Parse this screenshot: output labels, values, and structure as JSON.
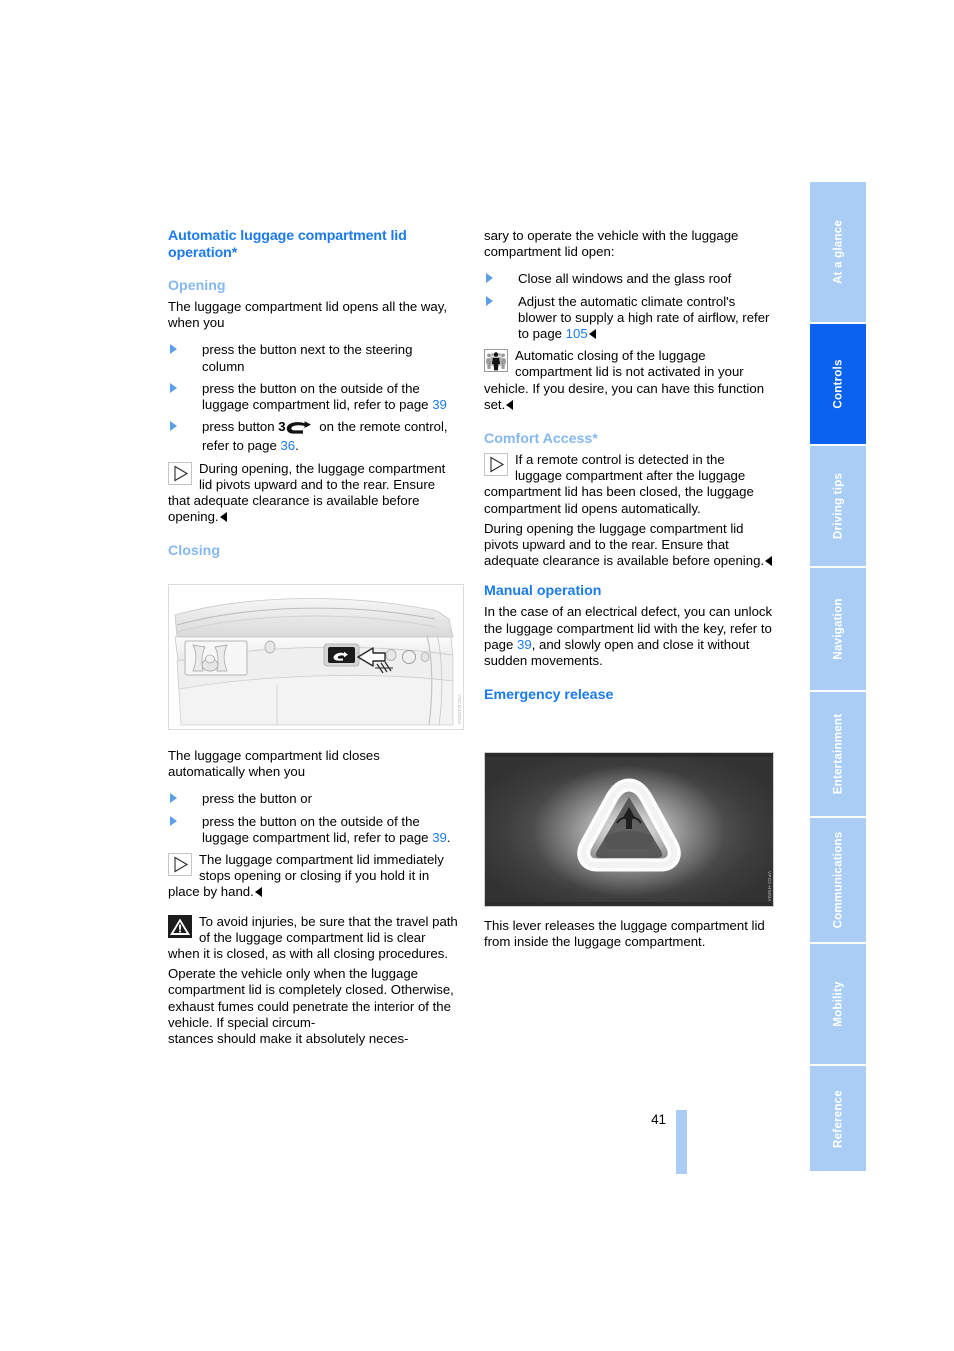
{
  "page": {
    "number": "41",
    "accent_blue": "#1a7aee",
    "light_blue": "#85b8f0",
    "tab_blue": "#a9cdf5",
    "tab_active_blue": "#0a62f0"
  },
  "left_column": {
    "section_title": "Automatic luggage compartment lid operation*",
    "opening": {
      "heading": "Opening",
      "intro": "The luggage compartment lid opens all the way, when you",
      "bullets": [
        {
          "text": "press the button next to the steering column"
        },
        {
          "text_before": "press the button on the outside of the luggage compartment lid, refer to page ",
          "page_ref": "39",
          "text_after": ""
        },
        {
          "text_before": "press button ",
          "bold": "3",
          "symbol": "open-trunk-icon",
          "text_mid": " on the remote control, refer to page ",
          "page_ref": "36",
          "text_after": "."
        }
      ],
      "note": {
        "icon": "note-triangle-icon",
        "text": "During opening, the luggage compartment lid pivots upward and to the rear. Ensure that adequate clearance is available before opening."
      }
    },
    "closing": {
      "heading": "Closing",
      "figure_caption": "VNCMJZ0WA",
      "figure_alt": "trunk-lid-interior-button-photo",
      "intro": "The luggage compartment lid closes automatically when you",
      "bullets": [
        {
          "text": "press the button or"
        },
        {
          "text_before": "press the button on the outside of the luggage compartment lid, refer to page ",
          "page_ref": "39",
          "text_after": "."
        }
      ],
      "note": {
        "icon": "note-triangle-icon",
        "text": "The luggage compartment lid immediately stops opening or closing if you hold it in place by hand."
      },
      "warning": {
        "icon": "warning-triangle-icon",
        "text": "To avoid injuries, be sure that the travel path of the luggage compartment lid is clear when it is closed, as with all closing procedures."
      },
      "warning_continued": [
        "Operate the vehicle only when the luggage compartment lid is completely closed. Otherwise, exhaust fumes could penetrate the interior of the vehicle. If special circum-"
      ],
      "warning_tail": "stances should make it absolutely neces-"
    }
  },
  "right_column": {
    "continued_intro": "sary to operate the vehicle with the luggage compartment lid open:",
    "continued_bullets": [
      {
        "text": "Close all windows and the glass roof"
      },
      {
        "text_before": "Adjust the automatic climate control's blower to supply a high rate of airflow, refer to page ",
        "page_ref": "105",
        "text_after": "",
        "endmark": true
      }
    ],
    "service_note": {
      "icon": "service-people-icon",
      "text": "Automatic closing of the luggage compartment lid is not activated in your vehicle. If you desire, you can have this function set."
    },
    "comfort_access": {
      "heading": "Comfort Access*",
      "note": {
        "icon": "note-triangle-icon",
        "text": "If a remote control is detected in the luggage compartment after the luggage compartment lid has been closed, the luggage compartment lid opens automatically."
      },
      "body": "During opening the luggage compartment lid pivots upward and to the rear. Ensure that adequate clearance is available before opening."
    },
    "manual_operation": {
      "heading": "Manual operation",
      "text_before": "In the case of an electrical defect, you can unlock the luggage compartment lid with the key, refer to page ",
      "page_ref": "39",
      "text_after": ", and slowly open and close it without sudden movements."
    },
    "emergency_release": {
      "heading": "Emergency release",
      "figure_caption": "VPD2-HWMA",
      "figure_alt": "glow-in-the-dark-emergency-release-handle-photo",
      "caption": "This lever releases the luggage compartment lid from inside the luggage compartment."
    }
  },
  "tabs": [
    {
      "label": "At a glance",
      "active": false
    },
    {
      "label": "Controls",
      "active": true
    },
    {
      "label": "Driving tips",
      "active": false
    },
    {
      "label": "Navigation",
      "active": false
    },
    {
      "label": "Entertainment",
      "active": false
    },
    {
      "label": "Communications",
      "active": false
    },
    {
      "label": "Mobility",
      "active": false
    },
    {
      "label": "Reference",
      "active": false
    }
  ]
}
